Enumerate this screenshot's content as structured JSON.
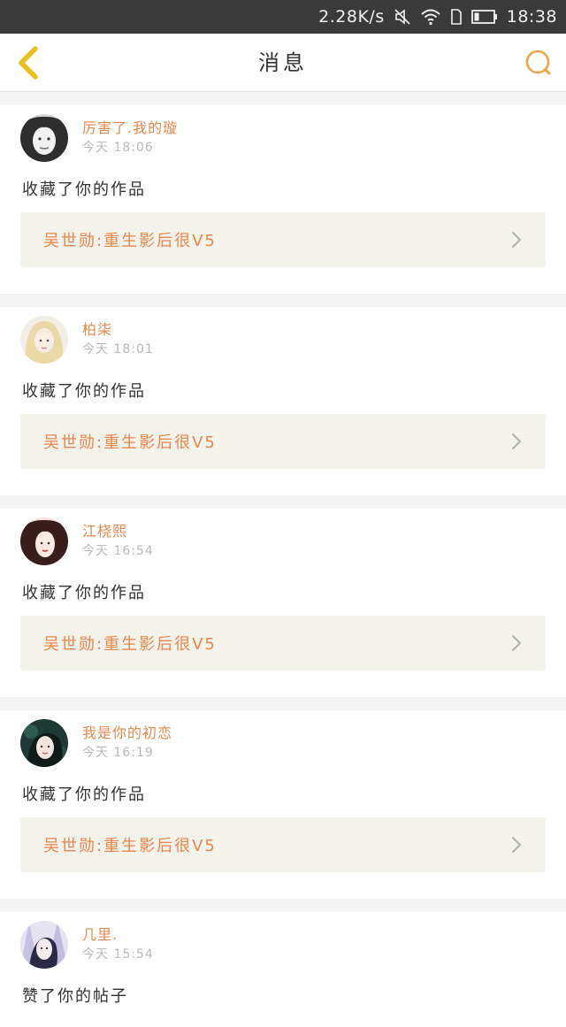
{
  "status_bar": {
    "speed": "2.28K/s",
    "time": "18:38"
  },
  "nav": {
    "title": "消息"
  },
  "colors": {
    "accent": "#e8874a",
    "back_icon": "#e8c21a",
    "search_icon": "#f0a44a"
  },
  "messages": [
    {
      "username": "厉害了.我的璇",
      "time": "今天 18:06",
      "action": "收藏了你的作品",
      "work_title": "吴世勋:重生影后很V5"
    },
    {
      "username": "柏柒",
      "time": "今天 18:01",
      "action": "收藏了你的作品",
      "work_title": "吴世勋:重生影后很V5"
    },
    {
      "username": "江桡熙",
      "time": "今天 16:54",
      "action": "收藏了你的作品",
      "work_title": "吴世勋:重生影后很V5"
    },
    {
      "username": "我是你的初恋",
      "time": "今天 16:19",
      "action": "收藏了你的作品",
      "work_title": "吴世勋:重生影后很V5"
    },
    {
      "username": "几里.",
      "time": "今天 15:54",
      "action": "赞了你的帖子"
    }
  ]
}
